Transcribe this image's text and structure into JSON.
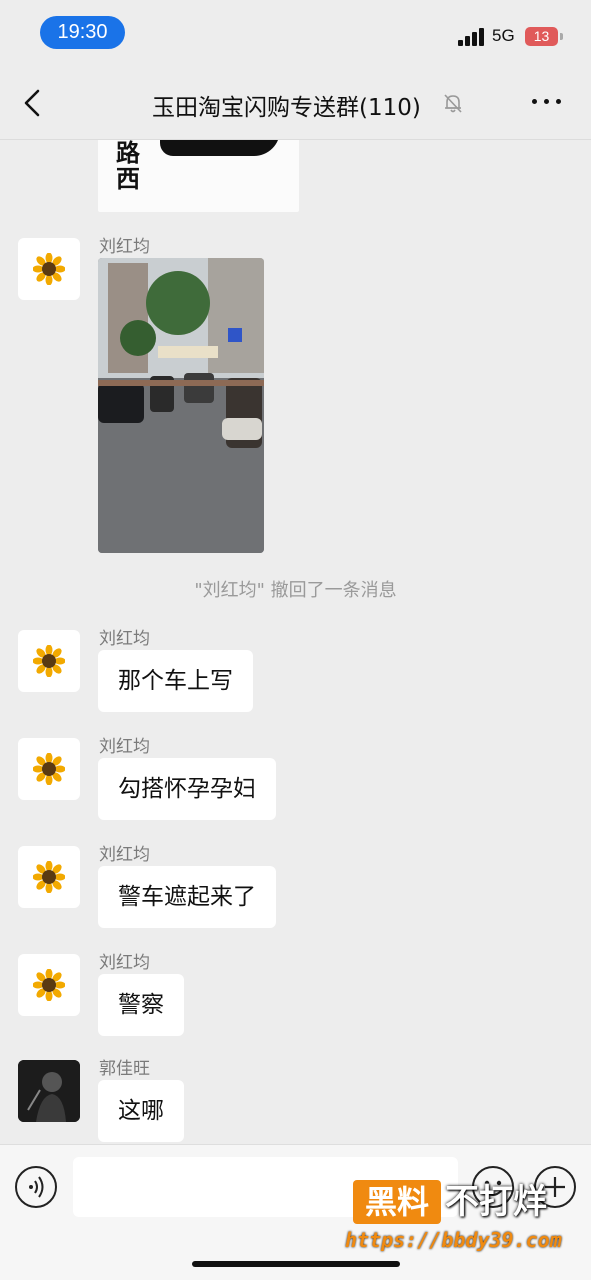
{
  "status_bar": {
    "time": "19:30",
    "network": "5G",
    "battery": "13"
  },
  "nav": {
    "title": "玉田淘宝闪购专送群(110)"
  },
  "previous_image": {
    "text": "路西"
  },
  "messages": [
    {
      "sender": "刘红均",
      "type": "image",
      "avatar": "sunflower-avatar"
    },
    {
      "sender": "刘红均",
      "type": "text",
      "text": "那个车上写",
      "avatar": "sunflower-avatar"
    },
    {
      "sender": "刘红均",
      "type": "text",
      "text": "勾搭怀孕孕妇",
      "avatar": "sunflower-avatar"
    },
    {
      "sender": "刘红均",
      "type": "text",
      "text": "警车遮起来了",
      "avatar": "sunflower-avatar"
    },
    {
      "sender": "刘红均",
      "type": "text",
      "text": "警察",
      "avatar": "sunflower-avatar"
    },
    {
      "sender": "郭佳旺",
      "type": "text",
      "text": "这哪",
      "avatar": "dark-photo-avatar"
    }
  ],
  "system_notice": "\"刘红均\" 撤回了一条消息",
  "input": {
    "value": ""
  },
  "watermark": {
    "box": "黑料",
    "text": "不打烊",
    "url": "https://bbdy39.com"
  }
}
